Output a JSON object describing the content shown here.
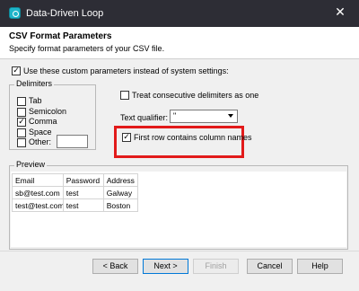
{
  "window": {
    "title": "Data-Driven Loop",
    "close_glyph": "✕",
    "app_icon": "data-loop-icon"
  },
  "header": {
    "title": "CSV Format Parameters",
    "subtitle": "Specify format parameters of your CSV file."
  },
  "use_custom": {
    "label": "Use these custom parameters instead of system settings:",
    "checked": true
  },
  "delimiters": {
    "legend": "Delimiters",
    "items": [
      {
        "label": "Tab",
        "checked": false
      },
      {
        "label": "Semicolon",
        "checked": false
      },
      {
        "label": "Comma",
        "checked": true
      },
      {
        "label": "Space",
        "checked": false
      },
      {
        "label": "Other:",
        "checked": false,
        "value": ""
      }
    ]
  },
  "consecutive": {
    "label": "Treat consecutive delimiters as one",
    "checked": false
  },
  "qualifier": {
    "label": "Text qualifier:",
    "value": "\""
  },
  "first_row": {
    "label": "First row contains column names",
    "checked": true
  },
  "highlight_color": "#e21a1a",
  "preview": {
    "legend": "Preview",
    "columns": [
      "Email",
      "Password",
      "Address"
    ],
    "rows": [
      [
        "sb@test.com",
        "test",
        "Galway"
      ],
      [
        "test@test.com",
        "test",
        "Boston"
      ]
    ]
  },
  "buttons": {
    "back": "< Back",
    "next": "Next >",
    "finish": "Finish",
    "cancel": "Cancel",
    "help": "Help"
  }
}
